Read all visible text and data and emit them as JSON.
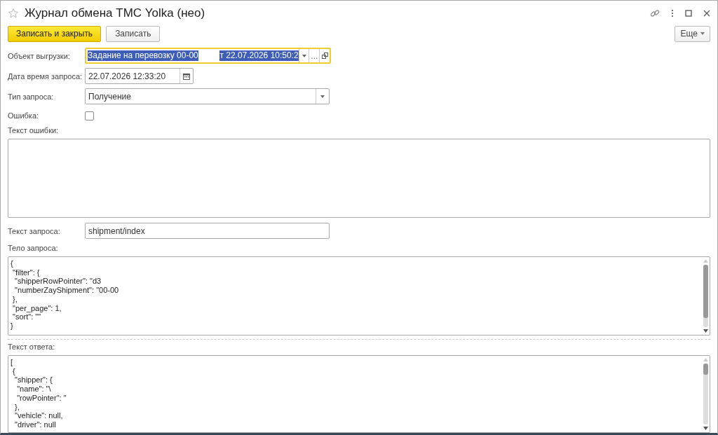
{
  "window": {
    "title": "Журнал обмена ТМС Yolka (нео)"
  },
  "toolbar": {
    "buttons": [
      {
        "label": "Записать и закрыть",
        "kind": "primary"
      },
      {
        "label": "Записать",
        "kind": "normal"
      }
    ],
    "more": {
      "label": "Еще"
    }
  },
  "fields": [
    {
      "label": "Объект выгрузки:",
      "kind": "object",
      "value_parts": [
        "Задание на перевозку 00-00",
        "т 22.07.2026 10:50:2"
      ],
      "select_button": "...",
      "focused": true
    },
    {
      "label": "Дата время запроса:",
      "kind": "date",
      "value": "22.07.2026 12:33:20"
    },
    {
      "label": "Тип запроса:",
      "kind": "select",
      "value": "Получение"
    },
    {
      "label": "Ошибка:",
      "kind": "checkbox",
      "checked": false
    }
  ],
  "error_text": {
    "label": "Текст ошибки:"
  },
  "request_text": {
    "label": "Текст запроса:",
    "value": "shipment/index"
  },
  "request_body": {
    "label": "Тело запроса:",
    "lines": [
      "{",
      " \"filter\": {",
      "  \"shipperRowPointer\": \"d3",
      "  \"numberZayShipment\": \"00-00",
      " },",
      " \"per_page\": 1,",
      " \"sort\": \"\"",
      "}"
    ]
  },
  "response_text": {
    "label": "Текст ответа:",
    "lines": [
      "[",
      " {",
      "  \"shipper\": {",
      "   \"name\": \"\\",
      "   \"rowPointer\": \"",
      "  },",
      "  \"vehicle\": null,",
      "  \"driver\": null"
    ]
  }
}
